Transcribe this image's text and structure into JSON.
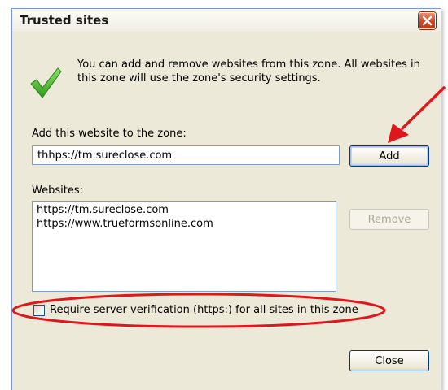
{
  "dialog": {
    "title": "Trusted sites",
    "description": "You can add and remove websites from this zone. All websites in this zone will use the zone's security settings.",
    "add_label": "Add this website to the zone:",
    "add_value": "thhps://tm.sureclose.com",
    "add_button": "Add",
    "websites_label": "Websites:",
    "websites": [
      "https://tm.sureclose.com",
      "https://www.trueformsonline.com"
    ],
    "remove_button": "Remove",
    "require_verification_label": "Require server verification (https:) for all sites in this zone",
    "require_verification_checked": false,
    "close_button": "Close"
  },
  "icons": {
    "check": "green-checkmark-icon",
    "close": "close-icon",
    "annotation_arrow": "red-arrow",
    "annotation_ellipse": "red-ellipse"
  },
  "colors": {
    "dialog_bg": "#ECE9D8",
    "annotation": "#e0161d",
    "check_green": "#3fae2a"
  }
}
